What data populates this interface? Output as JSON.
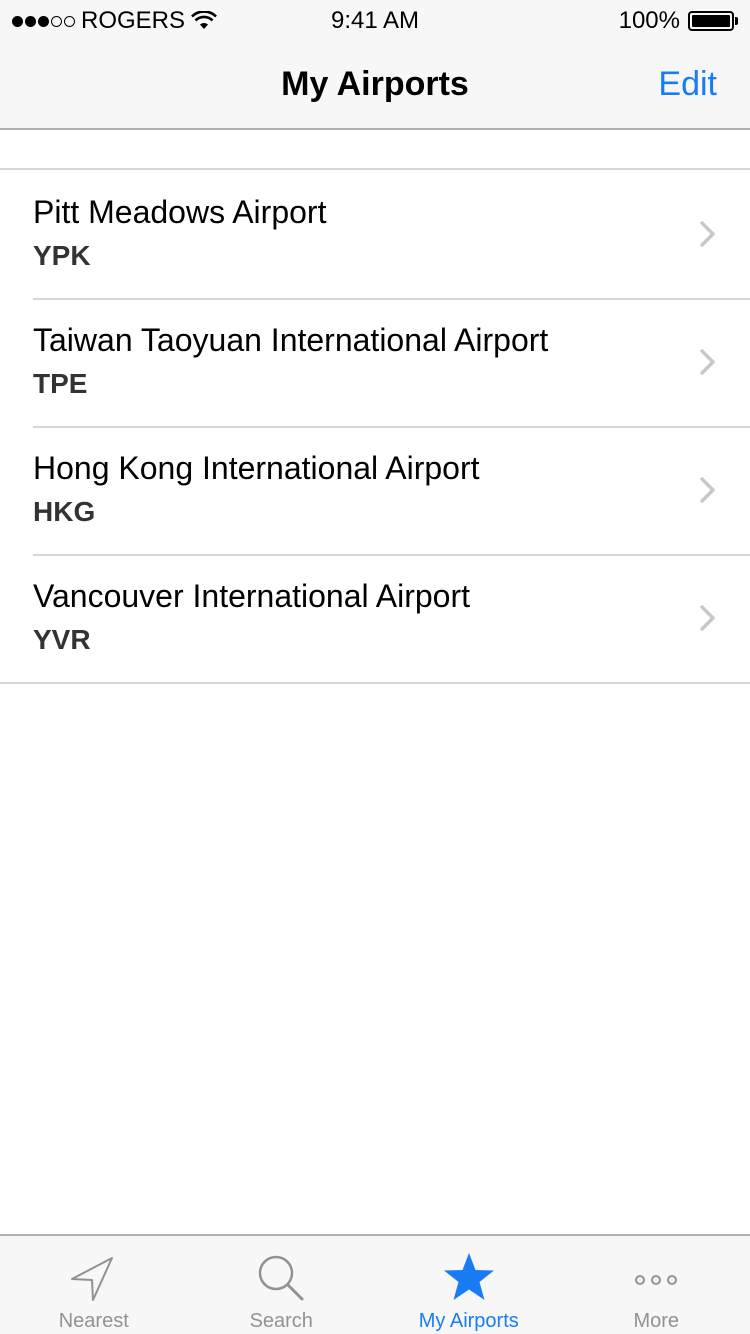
{
  "status_bar": {
    "carrier": "ROGERS",
    "time": "9:41 AM",
    "battery": "100%"
  },
  "nav": {
    "title": "My Airports",
    "edit_label": "Edit"
  },
  "airports": [
    {
      "name": "Pitt Meadows Airport",
      "code": "YPK"
    },
    {
      "name": "Taiwan Taoyuan International Airport",
      "code": "TPE"
    },
    {
      "name": "Hong Kong International Airport",
      "code": "HKG"
    },
    {
      "name": "Vancouver International Airport",
      "code": "YVR"
    }
  ],
  "tabs": [
    {
      "label": "Nearest",
      "icon": "location-arrow-icon"
    },
    {
      "label": "Search",
      "icon": "search-icon"
    },
    {
      "label": "My Airports",
      "icon": "star-icon"
    },
    {
      "label": "More",
      "icon": "more-icon"
    }
  ],
  "colors": {
    "accent": "#1a7cf5",
    "inactive": "#929292"
  }
}
